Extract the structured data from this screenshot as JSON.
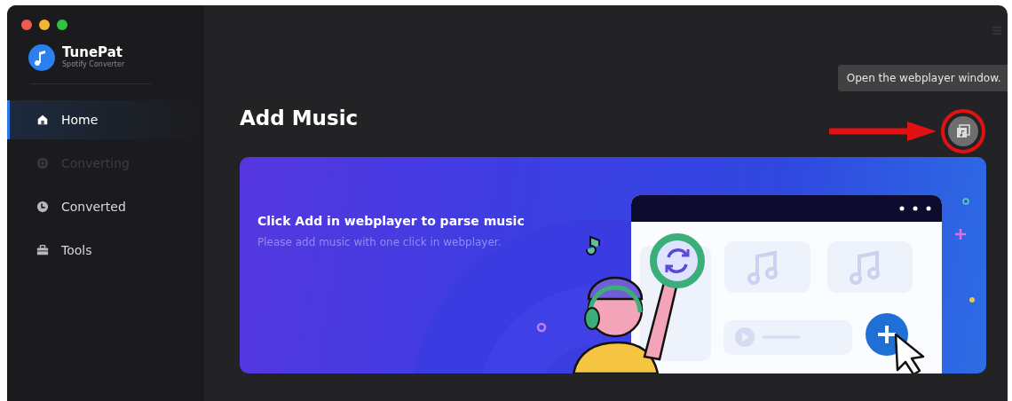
{
  "app": {
    "name": "TunePat",
    "subtitle": "Spotify Converter"
  },
  "sidebar": {
    "items": [
      {
        "kind": "home",
        "label": "Home",
        "selected": true,
        "disabled": false
      },
      {
        "kind": "converting",
        "label": "Converting",
        "selected": false,
        "disabled": true
      },
      {
        "kind": "converted",
        "label": "Converted",
        "selected": false,
        "disabled": false
      },
      {
        "kind": "tools",
        "label": "Tools",
        "selected": false,
        "disabled": false
      }
    ]
  },
  "main": {
    "title": "Add Music",
    "tooltip": "Open the webplayer window.",
    "banner": {
      "heading": "Click Add in webplayer to parse music",
      "subtext": "Please add music with one click in webplayer."
    }
  }
}
